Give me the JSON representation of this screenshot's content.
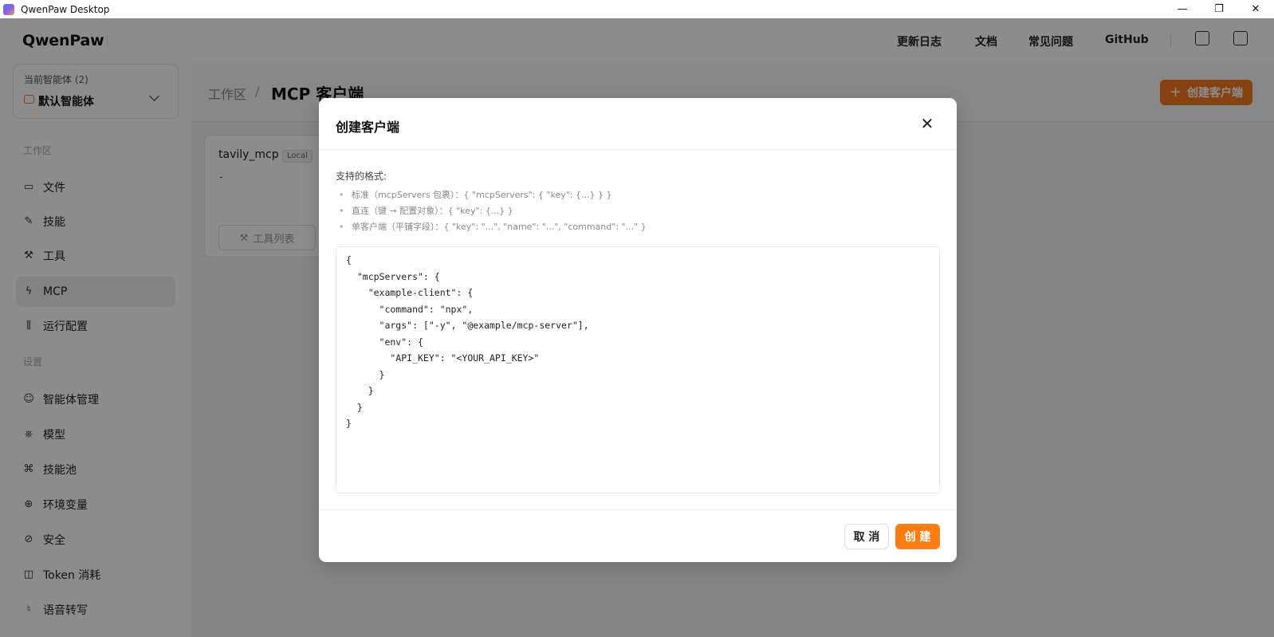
{
  "window": {
    "title": "QwenPaw Desktop",
    "controls": {
      "minimize": "—",
      "restore": "❐",
      "close": "✕"
    }
  },
  "header": {
    "logo": "QwenPaw",
    "nav": [
      "更新日志",
      "文档",
      "常见问题",
      "GitHub"
    ],
    "icons": [
      "language-icon",
      "display-icon"
    ]
  },
  "sidebar": {
    "agent_label": "当前智能体 (2)",
    "agent_name": "默认智能体",
    "workspace_label": "工作区",
    "workspace_items": [
      {
        "label": "文件",
        "icon": "folder-icon"
      },
      {
        "label": "技能",
        "icon": "skill-icon"
      },
      {
        "label": "工具",
        "icon": "wrench-icon"
      },
      {
        "label": "MCP",
        "icon": "lightning-icon",
        "active": true
      },
      {
        "label": "运行配置",
        "icon": "sliders-icon"
      }
    ],
    "settings_label": "设置",
    "settings_items": [
      {
        "label": "智能体管理",
        "icon": "user-gear-icon"
      },
      {
        "label": "模型",
        "icon": "model-icon"
      },
      {
        "label": "技能池",
        "icon": "command-icon"
      },
      {
        "label": "环境变量",
        "icon": "globe-icon"
      },
      {
        "label": "安全",
        "icon": "shield-icon"
      },
      {
        "label": "Token 消耗",
        "icon": "chart-icon"
      },
      {
        "label": "语音转写",
        "icon": "microphone-icon"
      }
    ]
  },
  "main": {
    "breadcrumb": [
      "工作区",
      "MCP 客户端"
    ],
    "breadcrumb_sep": "/",
    "create_button": "创建客户端",
    "card": {
      "name": "tavily_mcp",
      "badge": "Local",
      "description": "-",
      "tools_button": "工具列表"
    }
  },
  "modal": {
    "title": "创建客户端",
    "formats_label": "支持的格式:",
    "formats": [
      "标准（mcpServers 包裹）：{ \"mcpServers\": { \"key\": {...} } }",
      "直连（键 → 配置对象）：{ \"key\": {...} }",
      "单客户端（平铺字段）：{ \"key\": \"...\", \"name\": \"...\", \"command\": \"...\" }"
    ],
    "editor_lines": [
      "{",
      "  \"mcpServers\": {",
      "    \"example-client\": {",
      "      \"command\": \"npx\",",
      "      \"args\": [\"-y\", \"@example/mcp-server\"],",
      "      \"env\": {",
      "        \"API_KEY\": \"<YOUR_API_KEY>\"",
      "      }",
      "    }",
      "  }",
      "}"
    ],
    "cancel": "取 消",
    "confirm": "创 建",
    "close_icon": "close-icon"
  },
  "colors": {
    "accent": "#f47b20",
    "overlay": "rgba(0,0,0,0.45)"
  }
}
